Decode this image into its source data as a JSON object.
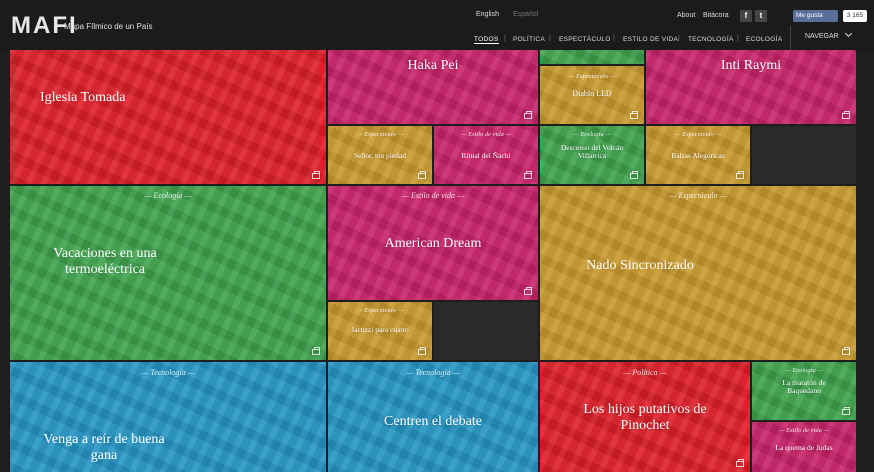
{
  "header": {
    "logo": "MAFI",
    "logo_subtitle": "Mapa Fílmico de un País",
    "lang_english": "English",
    "lang_spanish": "Español",
    "about": "About",
    "bitacora": "Bitácora",
    "facebook_icon": "f",
    "twitter_icon": "t",
    "like_label": "Me gusta",
    "like_count": "3 165",
    "navegar": "NAVEGAR"
  },
  "nav": [
    "TODOS",
    "POLÍTICA",
    "ESPECTÁCULO",
    "ESTILO DE VIDA",
    "TECNOLOGÍA",
    "ECOLOGÍA"
  ],
  "colors": {
    "politica": "#dd1f2a",
    "ecologia": "#3fa24d",
    "estilo_de_vida": "#c8236b",
    "espectaculo": "#c8992e",
    "tecnologia": "#2596c4"
  },
  "tiles": {
    "iglesia": {
      "title": "Iglesia Tomada"
    },
    "haka": {
      "title": "Haka Pei"
    },
    "diablo": {
      "category": "Espectáculo",
      "title": "Diablo LED"
    },
    "inti": {
      "title": "Inti Raymi"
    },
    "senor": {
      "category": "Espectáculo",
      "title": "Señor, ten piedad"
    },
    "ritual": {
      "category": "Estilo de vida",
      "title": "Ritual del Ñachi"
    },
    "descenso": {
      "category": "Ecología",
      "title": "Descenso del Volcán Villarrica"
    },
    "balsas": {
      "category": "Espectáculo",
      "title": "Balsas Alegóricas"
    },
    "vacaciones": {
      "category": "Ecología",
      "title": "Vacaciones en una termoeléctrica"
    },
    "american": {
      "category": "Estilo de vida",
      "title": "American Dream"
    },
    "nado": {
      "category": "Espectáculo",
      "title": "Nado Sincronizado"
    },
    "jacuzzi": {
      "category": "Espectáculo",
      "title": "Jacuzzi para cuatro"
    },
    "venga": {
      "category": "Tecnología",
      "title": "Venga a reír de buena gana"
    },
    "centren": {
      "category": "Tecnología",
      "title": "Centren el debate"
    },
    "hijos": {
      "category": "Política",
      "title": "Los hijos putativos de Pinochet"
    },
    "maraton": {
      "category": "Ecología",
      "title": "La maratón de Baquedano"
    },
    "quema": {
      "category": "Estilo de vida",
      "title": "La quema de Judas"
    }
  }
}
